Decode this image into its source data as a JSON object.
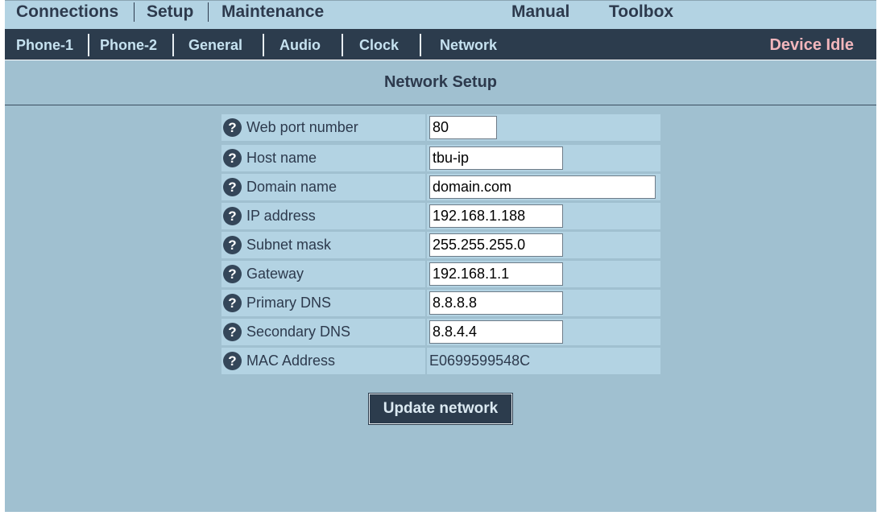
{
  "top_menu": {
    "connections": "Connections",
    "setup": "Setup",
    "maintenance": "Maintenance",
    "manual": "Manual",
    "toolbox": "Toolbox"
  },
  "sub_menu": {
    "phone1": "Phone-1",
    "phone2": "Phone-2",
    "general": "General",
    "audio": "Audio",
    "clock": "Clock",
    "network": "Network"
  },
  "status": {
    "text": "Device Idle",
    "color": "#f2b6bc"
  },
  "page": {
    "title": "Network Setup"
  },
  "help_icon": {
    "icon": "question-circle-icon",
    "glyph": "?"
  },
  "fields": {
    "web_port": {
      "label": "Web port number",
      "value": "80"
    },
    "host_name": {
      "label": "Host name",
      "value": "tbu-ip"
    },
    "domain_name": {
      "label": "Domain name",
      "value": "domain.com"
    },
    "ip_address": {
      "label": "IP address",
      "value": "192.168.1.188"
    },
    "subnet_mask": {
      "label": "Subnet mask",
      "value": "255.255.255.0"
    },
    "gateway": {
      "label": "Gateway",
      "value": "192.168.1.1"
    },
    "primary_dns": {
      "label": "Primary DNS",
      "value": "8.8.8.8"
    },
    "secondary_dns": {
      "label": "Secondary DNS",
      "value": "8.8.4.4"
    },
    "mac_address": {
      "label": "MAC Address",
      "value": "E0699599548C"
    }
  },
  "actions": {
    "update_label": "Update network"
  },
  "colors": {
    "top_menu_bg": "#b3d3e3",
    "sub_menu_bg": "#2c3c4d",
    "content_bg": "#a0c0d0",
    "row_bg": "#b3d3e3"
  }
}
